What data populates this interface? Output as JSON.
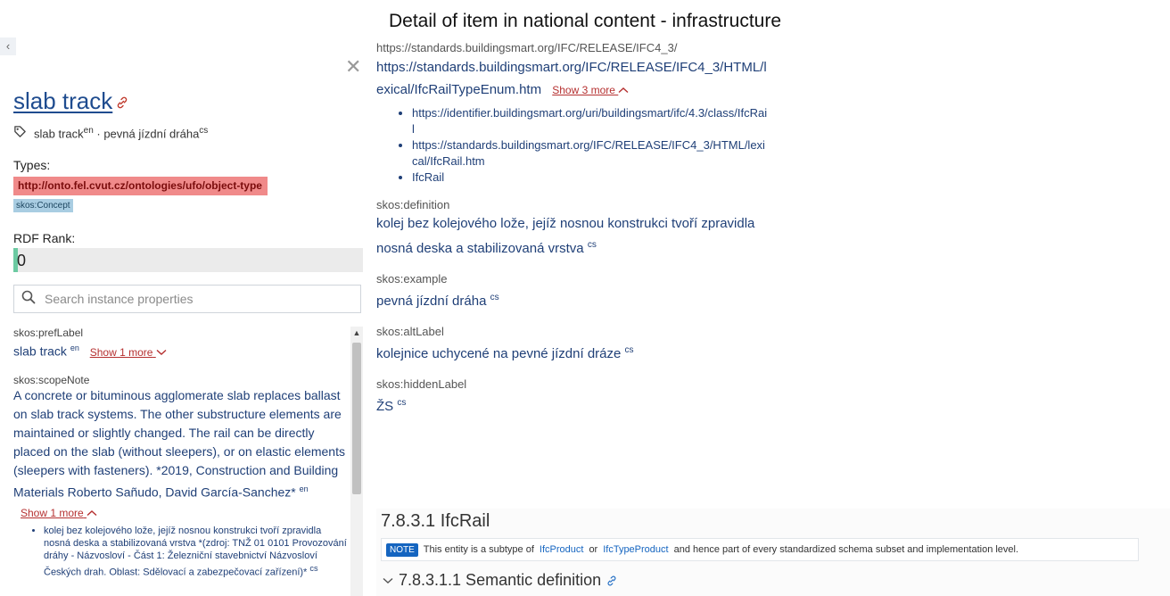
{
  "header": {
    "title": "Detail of item in national content - infrastructure"
  },
  "left_panel": {
    "collapse_glyph": "‹",
    "close_glyph": "✕",
    "title": "slab track",
    "tag": {
      "label_en": "slab track",
      "lang_en": "en",
      "separator": " · ",
      "label_cs": "pevná jízdní dráha",
      "lang_cs": "cs"
    },
    "types_label": "Types:",
    "types": [
      "http://onto.fel.cvut.cz/ontologies/ufo/object-type",
      "skos:Concept"
    ],
    "rdf_rank_label": "RDF Rank:",
    "rdf_rank_value": "0",
    "search_placeholder": "Search instance properties",
    "properties": {
      "preflabel_key": "skos:prefLabel",
      "preflabel_value": "slab track",
      "preflabel_lang": "en",
      "preflabel_more": "Show 1 more",
      "scopenote_key": "skos:scopeNote",
      "scopenote_value": "A concrete or bituminous agglomerate slab replaces ballast on slab track systems. The other substructure elements are maintained or slightly changed. The rail can be directly placed on the slab (without sleepers), or on elastic elements (sleepers with fasteners). *2019, Construction and Building Materials Roberto Sañudo, David García-Sanchez*",
      "scopenote_lang": "en",
      "scopenote_more": "Show 1 more",
      "scopenote_sub": "kolej bez kolejového lože, jejíž nosnou konstrukci tvoří zpravidla nosná deska a stabilizovaná vrstva *(zdroj: TNŽ 01 0101 Provozování dráhy - Názvosloví - Část 1: Železniční stavebnictví Názvosloví Českých drah. Oblast: Sdělovací a zabezpečovací zařízení)*",
      "scopenote_sub_lang": "cs"
    }
  },
  "right_panel": {
    "url_key": "https://standards.buildingsmart.org/IFC/RELEASE/IFC4_3/",
    "url_main": "https://standards.buildingsmart.org/IFC/RELEASE/IFC4_3/HTML/lexical/IfcRailTypeEnum.htm",
    "url_more": "Show 3 more",
    "url_list": [
      "https://identifier.buildingsmart.org/uri/buildingsmart/ifc/4.3/class/IfcRail",
      "https://standards.buildingsmart.org/IFC/RELEASE/IFC4_3/HTML/lexical/IfcRail.htm",
      "IfcRail"
    ],
    "definition_key": "skos:definition",
    "definition_value": "kolej bez kolejového lože, jejíž nosnou konstrukci tvoří zpravidla nosná deska a stabilizovaná vrstva",
    "definition_lang": "cs",
    "example_key": "skos:example",
    "example_value": "pevná jízdní dráha",
    "example_lang": "cs",
    "altlabel_key": "skos:altLabel",
    "altlabel_value": "kolejnice uchycené na pevné jízdní dráze",
    "altlabel_lang": "cs",
    "hiddenlabel_key": "skos:hiddenLabel",
    "hiddenlabel_value": "ŽS",
    "hiddenlabel_lang": "cs"
  },
  "ifc_doc": {
    "heading": "7.8.3.1 IfcRail",
    "note_badge": "NOTE",
    "note_pre": "This entity is a subtype of",
    "note_link1": "IfcProduct",
    "note_or": "or",
    "note_link2": "IfcTypeProduct",
    "note_post": "and hence part of every standardized schema subset and implementation level.",
    "subheading": "7.8.3.1.1 Semantic definition"
  },
  "colors": {
    "link": "#1f3f77",
    "show_more": "#b53030",
    "type_red": "#f08a8a",
    "type_blue": "#a9cde2",
    "rank_marker": "#6ccaa2",
    "note_badge": "#1565c0"
  }
}
